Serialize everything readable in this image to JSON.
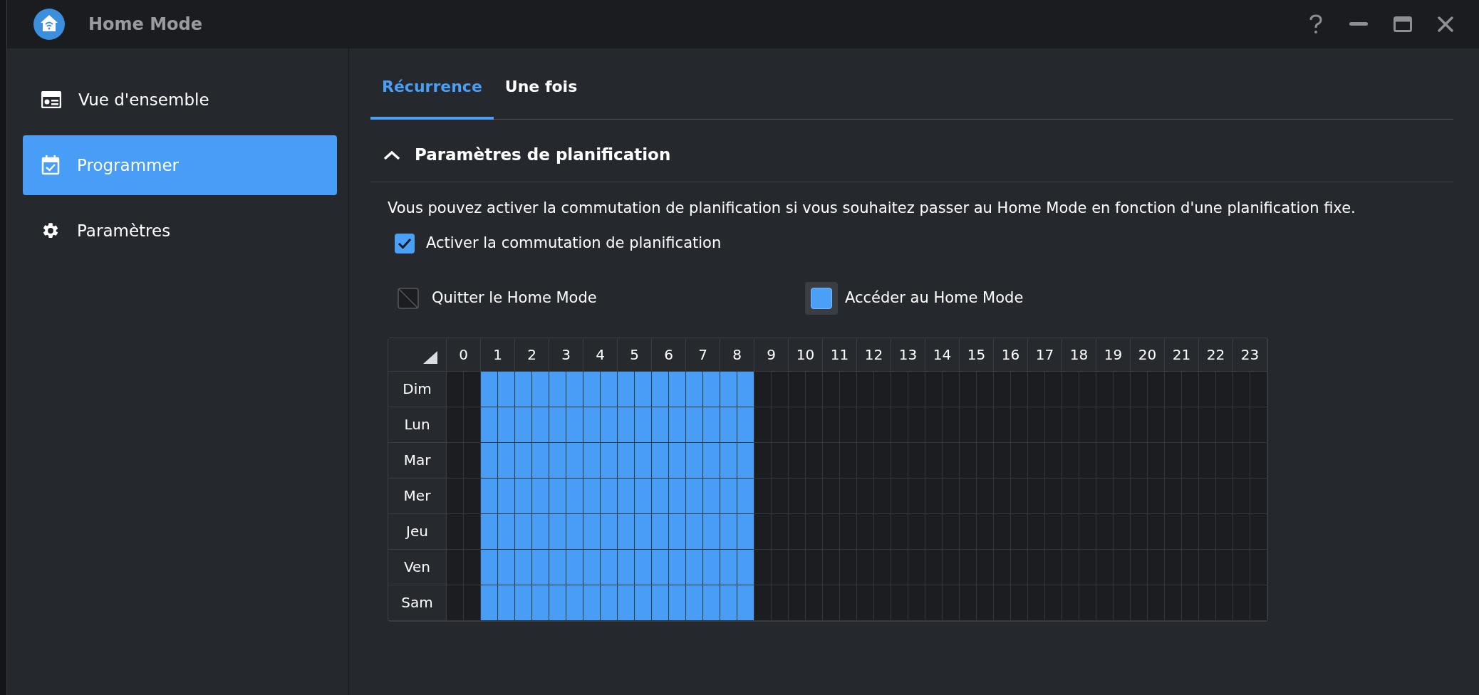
{
  "window": {
    "title": "Home Mode"
  },
  "sidebar": {
    "items": [
      {
        "label": "Vue d'ensemble",
        "kind": "overview",
        "selected": false
      },
      {
        "label": "Programmer",
        "kind": "calendar",
        "selected": true
      },
      {
        "label": "Paramètres",
        "kind": "gear",
        "selected": false
      }
    ]
  },
  "tabs": [
    {
      "label": "Récurrence",
      "selected": true
    },
    {
      "label": "Une fois",
      "selected": false
    }
  ],
  "section": {
    "title": "Paramètres de planification",
    "expanded": true,
    "description": "Vous pouvez activer la commutation de planification si vous souhaitez passer au Home Mode en fonction d'une planification fixe.",
    "enable": {
      "label": "Activer la commutation de planification",
      "checked": true
    },
    "legend": [
      {
        "label": "Quitter le Home Mode",
        "kind": "off",
        "selected": false
      },
      {
        "label": "Accéder au Home Mode",
        "kind": "on",
        "selected": true
      }
    ],
    "hours": [
      "0",
      "1",
      "2",
      "3",
      "4",
      "5",
      "6",
      "7",
      "8",
      "9",
      "10",
      "11",
      "12",
      "13",
      "14",
      "15",
      "16",
      "17",
      "18",
      "19",
      "20",
      "21",
      "22",
      "23"
    ],
    "days": [
      {
        "label": "Dim",
        "slots": [
          false,
          false,
          true,
          true,
          true,
          true,
          true,
          true,
          true,
          true,
          true,
          true,
          true,
          true,
          true,
          true,
          true,
          true,
          false,
          false,
          false,
          false,
          false,
          false,
          false,
          false,
          false,
          false,
          false,
          false,
          false,
          false,
          false,
          false,
          false,
          false,
          false,
          false,
          false,
          false,
          false,
          false,
          false,
          false,
          false,
          false,
          false,
          false
        ]
      },
      {
        "label": "Lun",
        "slots": [
          false,
          false,
          true,
          true,
          true,
          true,
          true,
          true,
          true,
          true,
          true,
          true,
          true,
          true,
          true,
          true,
          true,
          true,
          false,
          false,
          false,
          false,
          false,
          false,
          false,
          false,
          false,
          false,
          false,
          false,
          false,
          false,
          false,
          false,
          false,
          false,
          false,
          false,
          false,
          false,
          false,
          false,
          false,
          false,
          false,
          false,
          false,
          false
        ]
      },
      {
        "label": "Mar",
        "slots": [
          false,
          false,
          true,
          true,
          true,
          true,
          true,
          true,
          true,
          true,
          true,
          true,
          true,
          true,
          true,
          true,
          true,
          true,
          false,
          false,
          false,
          false,
          false,
          false,
          false,
          false,
          false,
          false,
          false,
          false,
          false,
          false,
          false,
          false,
          false,
          false,
          false,
          false,
          false,
          false,
          false,
          false,
          false,
          false,
          false,
          false,
          false,
          false
        ]
      },
      {
        "label": "Mer",
        "slots": [
          false,
          false,
          true,
          true,
          true,
          true,
          true,
          true,
          true,
          true,
          true,
          true,
          true,
          true,
          true,
          true,
          true,
          true,
          false,
          false,
          false,
          false,
          false,
          false,
          false,
          false,
          false,
          false,
          false,
          false,
          false,
          false,
          false,
          false,
          false,
          false,
          false,
          false,
          false,
          false,
          false,
          false,
          false,
          false,
          false,
          false,
          false,
          false
        ]
      },
      {
        "label": "Jeu",
        "slots": [
          false,
          false,
          true,
          true,
          true,
          true,
          true,
          true,
          true,
          true,
          true,
          true,
          true,
          true,
          true,
          true,
          true,
          true,
          false,
          false,
          false,
          false,
          false,
          false,
          false,
          false,
          false,
          false,
          false,
          false,
          false,
          false,
          false,
          false,
          false,
          false,
          false,
          false,
          false,
          false,
          false,
          false,
          false,
          false,
          false,
          false,
          false,
          false
        ]
      },
      {
        "label": "Ven",
        "slots": [
          false,
          false,
          true,
          true,
          true,
          true,
          true,
          true,
          true,
          true,
          true,
          true,
          true,
          true,
          true,
          true,
          true,
          true,
          false,
          false,
          false,
          false,
          false,
          false,
          false,
          false,
          false,
          false,
          false,
          false,
          false,
          false,
          false,
          false,
          false,
          false,
          false,
          false,
          false,
          false,
          false,
          false,
          false,
          false,
          false,
          false,
          false,
          false
        ]
      },
      {
        "label": "Sam",
        "slots": [
          false,
          false,
          true,
          true,
          true,
          true,
          true,
          true,
          true,
          true,
          true,
          true,
          true,
          true,
          true,
          true,
          true,
          true,
          false,
          false,
          false,
          false,
          false,
          false,
          false,
          false,
          false,
          false,
          false,
          false,
          false,
          false,
          false,
          false,
          false,
          false,
          false,
          false,
          false,
          false,
          false,
          false,
          false,
          false,
          false,
          false,
          false,
          false
        ]
      }
    ]
  }
}
